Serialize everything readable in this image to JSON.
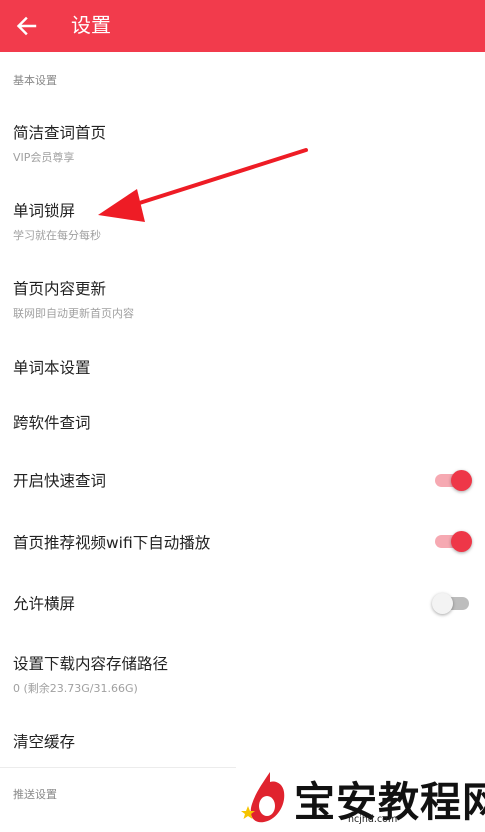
{
  "header": {
    "title": "设置",
    "back_icon": "arrow-left-icon",
    "background": "#f23b4c"
  },
  "sections": {
    "basic": "基本设置",
    "push": "推送设置"
  },
  "items": [
    {
      "label": "简洁查词首页",
      "sub": "VIP会员尊享"
    },
    {
      "label": "单词锁屏",
      "sub": "学习就在每分每秒"
    },
    {
      "label": "首页内容更新",
      "sub": "联网即自动更新首页内容"
    },
    {
      "label": "单词本设置"
    },
    {
      "label": "跨软件查词"
    },
    {
      "label": "开启快速查词",
      "toggle": true
    },
    {
      "label": "首页推荐视频wifi下自动播放",
      "toggle": true
    },
    {
      "label": "允许横屏",
      "toggle": false
    },
    {
      "label": "设置下载内容存储路径",
      "sub": "0 (剩余23.73G/31.66G)"
    },
    {
      "label": "清空缓存"
    }
  ],
  "annotation": {
    "icon": "red-arrow-annotation",
    "color": "#ee1c25"
  },
  "watermark": {
    "brand": "宝安教程网",
    "url": "hcjhd.com",
    "logo_icon": "watermark-logo-icon"
  },
  "colors": {
    "accent": "#f23b4c",
    "toggle_on": "#ee3748",
    "toggle_off": "#bdbdbd"
  }
}
